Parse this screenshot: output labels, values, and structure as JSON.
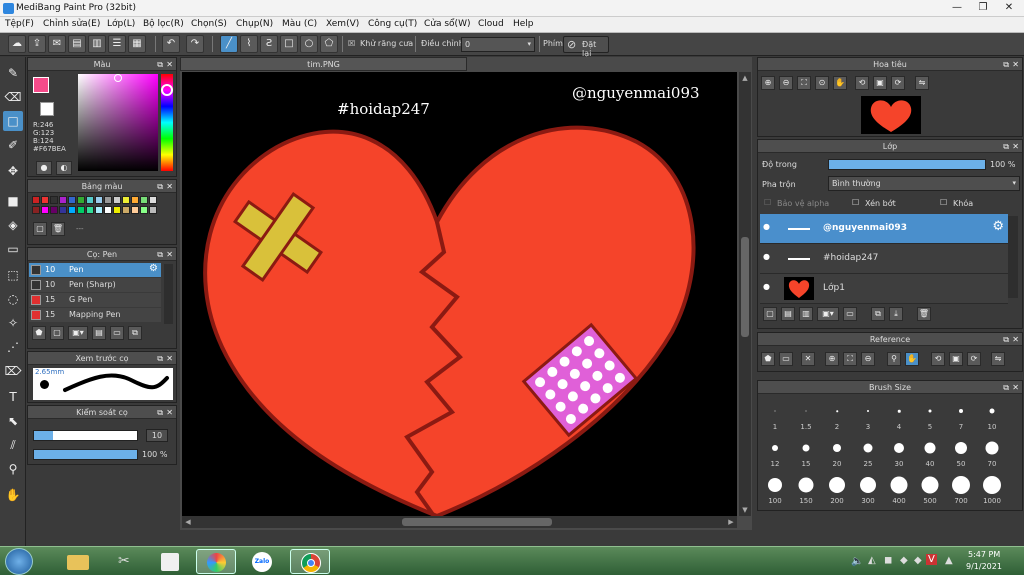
{
  "app": {
    "title": "MediBang Paint Pro (32bit)"
  },
  "menu": [
    "Tệp(F)",
    "Chỉnh sửa(E)",
    "Lớp(L)",
    "Bộ lọc(R)",
    "Chọn(S)",
    "Chụp(N)",
    "Màu (C)",
    "Xem(V)",
    "Công cụ(T)",
    "Cửa sổ(W)",
    "Cloud",
    "Help"
  ],
  "toolbar": {
    "antialias_label": "Khử răng cưa",
    "adjust_label": "Điều chỉnh",
    "adjust_value": "0",
    "key_label": "Phím",
    "reset_label": "Đặt lại"
  },
  "color_panel": {
    "title": "Màu",
    "r": "R:246",
    "g": "G:123",
    "b": "B:124",
    "hex": "#F67BEA",
    "fg_color": "#F64B8A",
    "bg_color": "#FFFFFF"
  },
  "palette_panel": {
    "title": "Bảng màu",
    "sep_label": "---"
  },
  "brush_panel": {
    "title": "Cọ: Pen",
    "items": [
      {
        "size": "10",
        "name": "Pen",
        "color": "#333333"
      },
      {
        "size": "10",
        "name": "Pen (Sharp)",
        "color": "#333333"
      },
      {
        "size": "15",
        "name": "G Pen",
        "color": "#e03030"
      },
      {
        "size": "15",
        "name": "Mapping Pen",
        "color": "#e03030"
      }
    ]
  },
  "preview_panel": {
    "title": "Xem trước cọ",
    "size_label": "2.65mm"
  },
  "control_panel": {
    "title": "Kiểm soát cọ",
    "size_value": "10",
    "opacity_value": "100 %"
  },
  "document": {
    "tab": "tim.PNG",
    "text1": "#hoidap247",
    "text2": "@nguyenmai093"
  },
  "navigator": {
    "title": "Hoa tiêu"
  },
  "layer_panel": {
    "title": "Lớp",
    "opacity_label": "Độ trong",
    "opacity_value": "100 %",
    "blend_label": "Pha trộn",
    "blend_value": "Bình thường",
    "protect_alpha": "Bảo vệ alpha",
    "clipping": "Xén bớt",
    "lock": "Khóa",
    "layers": [
      {
        "name": "@nguyenmai093"
      },
      {
        "name": "#hoidap247"
      },
      {
        "name": "Lớp1"
      }
    ]
  },
  "reference_panel": {
    "title": "Reference"
  },
  "brush_size_panel": {
    "title": "Brush Size",
    "sizes": [
      "1",
      "1.5",
      "2",
      "3",
      "4",
      "5",
      "7",
      "10",
      "12",
      "15",
      "20",
      "25",
      "30",
      "40",
      "50",
      "70",
      "100",
      "150",
      "200",
      "300",
      "400",
      "500",
      "700",
      "1000"
    ]
  },
  "taskbar": {
    "time": "5:47 PM",
    "date": "9/1/2021",
    "zalo_label": "Zalo"
  },
  "colors": {
    "heart": "#F5442A",
    "heart_outline": "#8B1A12",
    "bandage": "#D9C13A",
    "patch": "#E060D8",
    "accent": "#4A90C8"
  }
}
